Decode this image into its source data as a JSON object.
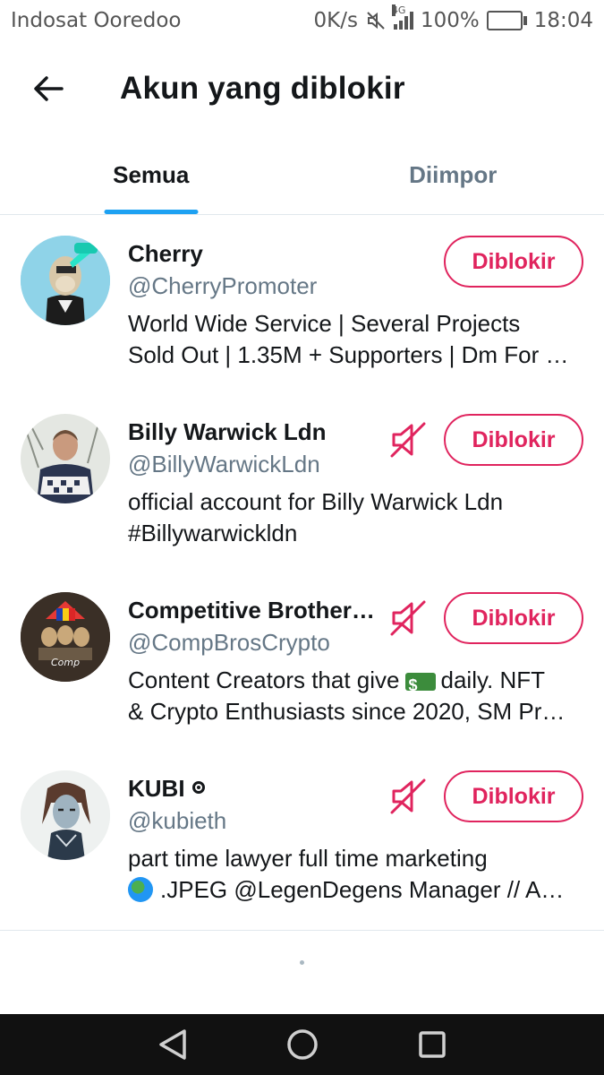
{
  "status_bar": {
    "carrier": "Indosat Ooredoo",
    "speed": "0K/s",
    "network": "4G",
    "battery": "100%",
    "time": "18:04",
    "battery_color": "#4caf50"
  },
  "header": {
    "title": "Akun yang diblokir",
    "back_icon": "arrow-left-icon"
  },
  "tabs": [
    {
      "label": "Semua",
      "active": true
    },
    {
      "label": "Diimpor",
      "active": false
    }
  ],
  "accent_color": "#1da1f2",
  "block_color": "#e0245e",
  "accounts": [
    {
      "name": "Cherry",
      "handle": "@CherryPromoter",
      "bio_line1": "World Wide Service | Several Projects",
      "bio_line2": "Sold Out | 1.35M + Supporters | Dm For …",
      "muted": false,
      "button": "Diblokir"
    },
    {
      "name": "Billy Warwick Ldn",
      "handle": "@BillyWarwickLdn",
      "bio_line1": "official account for Billy Warwick Ldn",
      "bio_line2": "#Billywarwickldn",
      "muted": true,
      "button": "Diblokir"
    },
    {
      "name": "Competitive Brother…",
      "handle": "@CompBrosCrypto",
      "bio_line1_a": "Content Creators that give",
      "bio_line1_b": "daily. NFT",
      "bio_line2": "& Crypto Enthusiasts since 2020, SM Pr…",
      "muted": true,
      "button": "Diblokir"
    },
    {
      "name": "KUBI",
      "handle": "@kubieth",
      "bio_line1": "part time lawyer full time marketing",
      "bio_line2": ".JPEG @LegenDegens Manager // A…",
      "muted": true,
      "button": "Diblokir"
    }
  ],
  "nav": {
    "back": "triangle-back-icon",
    "home": "circle-home-icon",
    "recents": "square-recents-icon"
  }
}
